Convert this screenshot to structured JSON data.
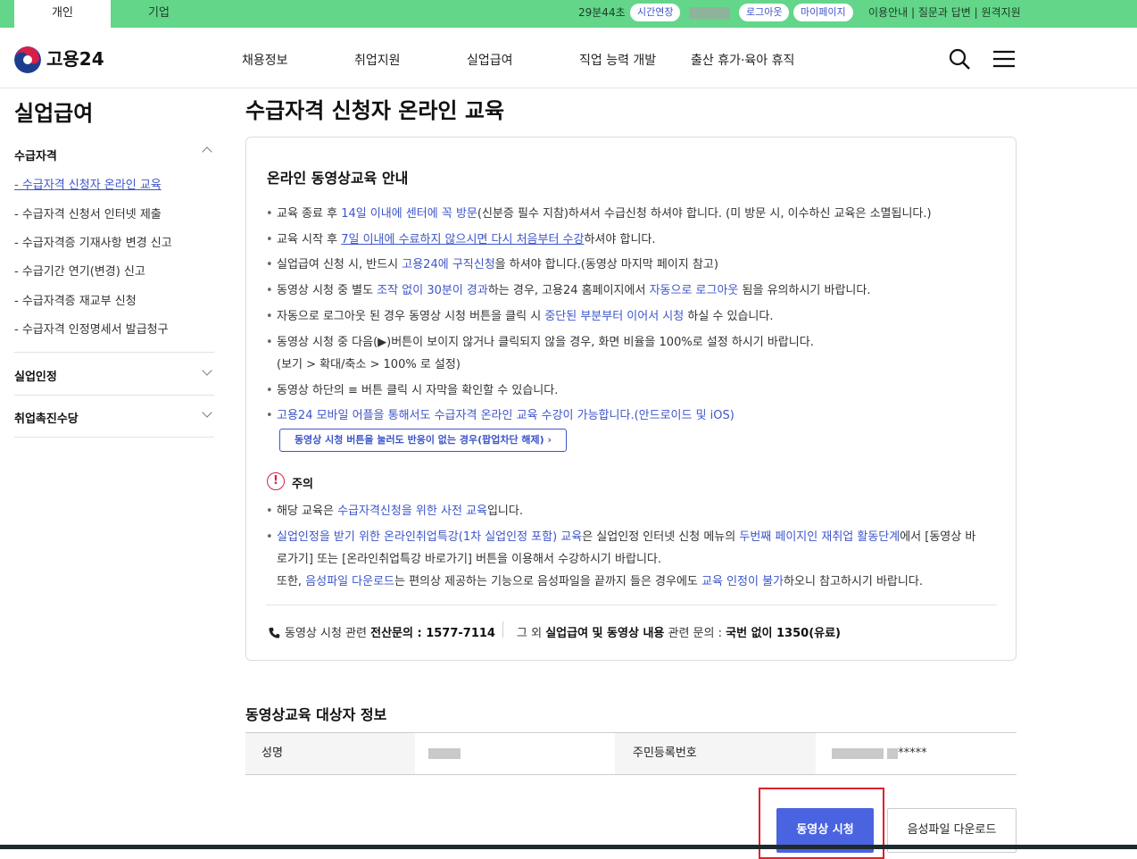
{
  "topbar": {
    "tabs": [
      "개인",
      "기업"
    ],
    "timer": "29분44초",
    "extend_label": "시간연장",
    "logout_label": "로그아웃",
    "mypage_label": "마이페이지",
    "links": "이용안내 | 질문과 답변 | 원격지원"
  },
  "header": {
    "logo_text": "고용24",
    "nav": [
      "채용정보",
      "취업지원",
      "실업급여",
      "직업 능력 개발",
      "출산 휴가·육아 휴직"
    ]
  },
  "sidebar": {
    "title": "실업급여",
    "sections": [
      {
        "label": "수급자격",
        "items": [
          "- 수급자격 신청자 온라인 교육",
          "- 수급자격 신청서 인터넷 제출",
          "- 수급자격증 기재사항 변경 신고",
          "- 수급기간 연기(변경) 신고",
          "- 수급자격증 재교부 신청",
          "- 수급자격 인정명세서 발급청구"
        ]
      },
      {
        "label": "실업인정"
      },
      {
        "label": "취업촉진수당"
      }
    ]
  },
  "main": {
    "page_title": "수급자격 신청자 온라인 교육",
    "box_title": "온라인 동영상교육 안내",
    "notices": [
      [
        {
          "t": "교육 종료 후 "
        },
        {
          "t": "14일 이내에 센터에 꼭 방문",
          "c": "blue"
        },
        {
          "t": "(신분증 필수 지참)하셔서 수급신청 하셔야 합니다. (미 방문 시, 이수하신 교육은 소멸됩니다.)"
        }
      ],
      [
        {
          "t": "교육 시작 후 "
        },
        {
          "t": "7일 이내에 수료하지 않으시면 다시 처음부터 수강",
          "c": "blue u"
        },
        {
          "t": "하셔야 합니다."
        }
      ],
      [
        {
          "t": "실업급여 신청 시, 반드시 "
        },
        {
          "t": "고용24에 구직신청",
          "c": "blue"
        },
        {
          "t": "을 하셔야 합니다.(동영상 마지막 페이지 참고)"
        }
      ],
      [
        {
          "t": "동영상 시청 중 별도 "
        },
        {
          "t": "조작 없이 30분이 경과",
          "c": "blue"
        },
        {
          "t": "하는 경우, 고용24 홈페이지에서 "
        },
        {
          "t": "자동으로 로그아웃",
          "c": "blue"
        },
        {
          "t": " 됨을 유의하시기 바랍니다."
        }
      ],
      [
        {
          "t": "자동으로 로그아웃 된 경우 동영상 시청 버튼을 클릭 시 "
        },
        {
          "t": "중단된 부분부터 이어서 시청",
          "c": "blue"
        },
        {
          "t": " 하실 수 있습니다."
        }
      ],
      [
        {
          "t": "동영상 시청 중 다음(▶)버튼이 보이지 않거나 클릭되지 않을 경우, 화면 비율을 100%로 설정 하시기 바랍니다."
        }
      ],
      [
        {
          "t": "(보기 > 확대/축소 > 100% 로 설정)"
        }
      ],
      [
        {
          "t": "동영상 하단의 ≡ 버튼 클릭 시 자막을 확인할 수 있습니다."
        }
      ],
      [
        {
          "t": "고용24 모바일 어플을 통해서도 수급자격 온라인 교육 수강이 가능합니다.(안드로이드 및 iOS)",
          "c": "blue"
        }
      ]
    ],
    "popup_button": "동영상 시청 버튼을 눌러도 반응이 없는 경우(팝업차단 해제)  ›",
    "caution_label": "주의",
    "cautions": [
      [
        {
          "t": "해당 교육은 "
        },
        {
          "t": "수급자격신청을 위한 사전 교육",
          "c": "blue"
        },
        {
          "t": "입니다."
        }
      ],
      [
        {
          "t": "실업인정을 받기 위한 온라인취업특강(1차 실업인정 포함) 교육",
          "c": "blue"
        },
        {
          "t": "은 실업인정 인터넷 신청 메뉴의 "
        },
        {
          "t": "두번째 페이지인 재취업 활동단계",
          "c": "blue"
        },
        {
          "t": "에서 [동영상 바"
        }
      ],
      [
        {
          "t": "로가기] 또는 [온라인취업특강 바로가기] 버튼을 이용해서 수강하시기 바랍니다."
        }
      ],
      [
        {
          "t": "또한, "
        },
        {
          "t": "음성파일 다운로드",
          "c": "blue"
        },
        {
          "t": "는 편의상 제공하는 기능으로 음성파일을 끝까지 들은 경우에도 "
        },
        {
          "t": "교육 인정이 불가",
          "c": "blue"
        },
        {
          "t": "하오니 참고하시기 바랍니다."
        }
      ]
    ],
    "contact1": [
      {
        "t": "동영상 시청 관련 "
      },
      {
        "t": "전산문의 : 1577-7114",
        "c": "bold"
      }
    ],
    "contact2": [
      {
        "t": "그 외 "
      },
      {
        "t": "실업급여 및 동영상 내용",
        "c": "bold"
      },
      {
        "t": " 관련 문의 : "
      },
      {
        "t": "국번 없이 1350(유료)",
        "c": "bold"
      }
    ],
    "target_title": "동영상교육 대상자 정보",
    "name_label": "성명",
    "rrn_label": "주민등록번호",
    "rrn_suffix": "*****",
    "watch_button": "동영상 시청",
    "audio_button": "음성파일 다운로드"
  },
  "colors": {
    "topbar": "#63d68a",
    "accent": "#3d55c9",
    "primary_button": "#4a63e0",
    "highlight": "#e0202b"
  }
}
